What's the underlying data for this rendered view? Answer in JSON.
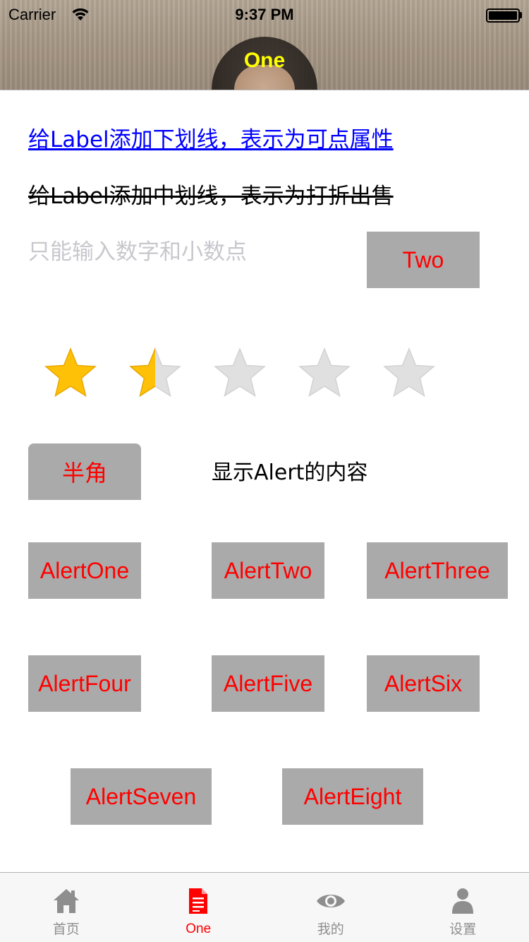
{
  "status_bar": {
    "carrier": "Carrier",
    "time": "9:37 PM"
  },
  "nav": {
    "title": "One",
    "title_color": "#ffff00"
  },
  "content": {
    "underline_label": "给Label添加下划线，表示为可点属性",
    "strikethrough_label": "给Label添加中划线，表示为打折出售",
    "number_input": {
      "value": "",
      "placeholder": "只能输入数字和小数点"
    },
    "two_button": "Two",
    "rating": {
      "value": 1.5,
      "max": 5
    },
    "half_button": "半角",
    "alert_content_label": "显示Alert的内容",
    "alert_buttons": [
      "AlertOne",
      "AlertTwo",
      "AlertThree",
      "AlertFour",
      "AlertFive",
      "AlertSix",
      "AlertSeven",
      "AlertEight"
    ]
  },
  "tab_bar": {
    "items": [
      {
        "label": "首页",
        "icon": "home-icon",
        "active": false
      },
      {
        "label": "One",
        "icon": "document-icon",
        "active": true
      },
      {
        "label": "我的",
        "icon": "eye-icon",
        "active": false
      },
      {
        "label": "设置",
        "icon": "person-icon",
        "active": false
      }
    ]
  },
  "colors": {
    "button_bg": "#aaaaaa",
    "button_text": "#ff0000",
    "link": "#0000ff",
    "star_filled": "#ffc107",
    "star_empty": "#e0e0e0",
    "tab_active": "#ff0000",
    "tab_inactive": "#8e8e8e"
  }
}
